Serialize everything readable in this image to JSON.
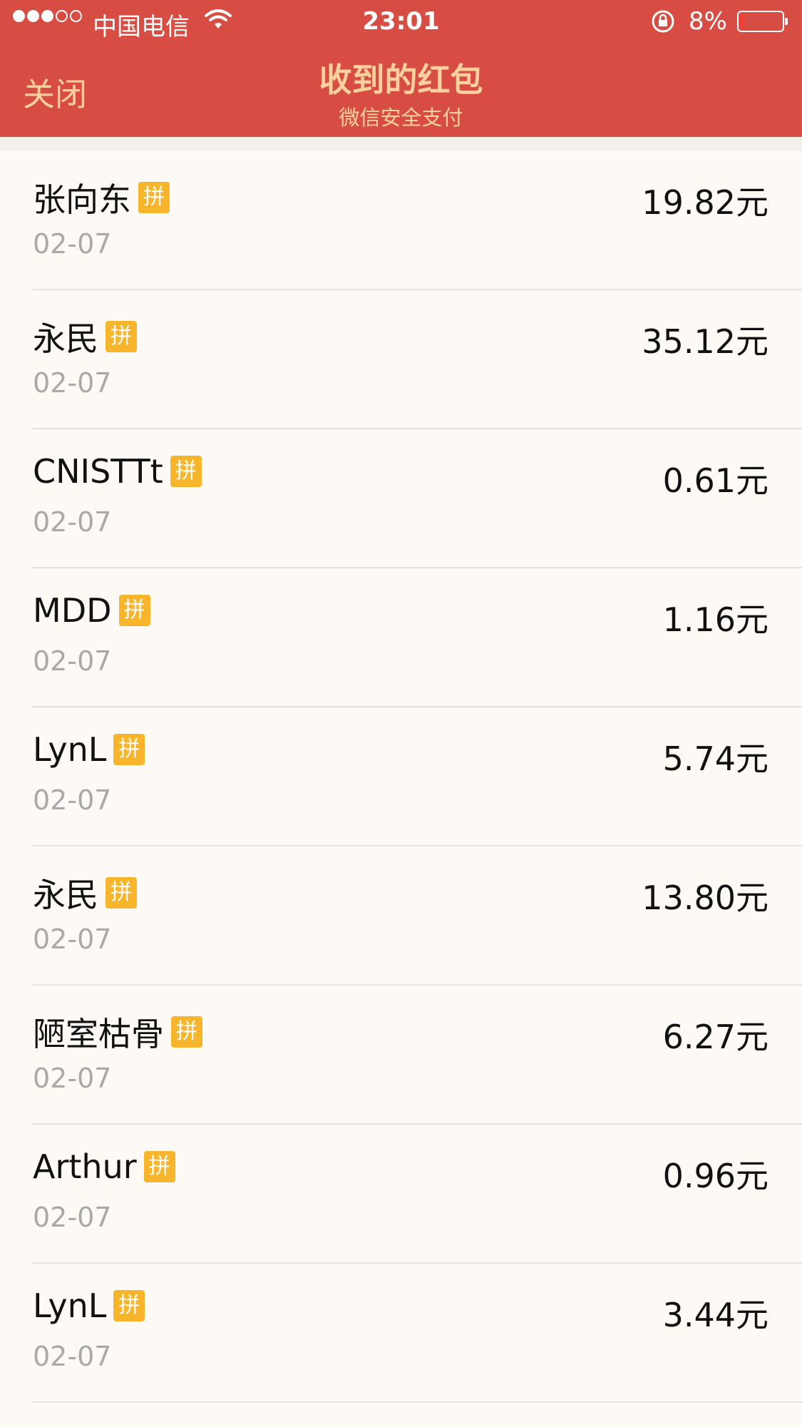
{
  "status_bar": {
    "carrier": "中国电信",
    "time": "23:01",
    "battery_percent": "8%",
    "battery_level": 0.08,
    "battery_color": "#ff3b30"
  },
  "header": {
    "close_label": "关闭",
    "title": "收到的红包",
    "subtitle": "微信安全支付",
    "background_color": "#d74d43",
    "text_color": "#fad19d"
  },
  "badge_label": "拼",
  "badge_color": "#f7b52c",
  "records": [
    {
      "name": "张向东",
      "badge": "拼",
      "date": "02-07",
      "amount": "19.82元"
    },
    {
      "name": "永民",
      "badge": "拼",
      "date": "02-07",
      "amount": "35.12元"
    },
    {
      "name": "CNISTTt",
      "badge": "拼",
      "date": "02-07",
      "amount": "0.61元"
    },
    {
      "name": "MDD",
      "badge": "拼",
      "date": "02-07",
      "amount": "1.16元"
    },
    {
      "name": "LynL",
      "badge": "拼",
      "date": "02-07",
      "amount": "5.74元"
    },
    {
      "name": "永民",
      "badge": "拼",
      "date": "02-07",
      "amount": "13.80元"
    },
    {
      "name": "陋室枯骨",
      "badge": "拼",
      "date": "02-07",
      "amount": "6.27元"
    },
    {
      "name": "Arthur",
      "badge": "拼",
      "date": "02-07",
      "amount": "0.96元"
    },
    {
      "name": "LynL",
      "badge": "拼",
      "date": "02-07",
      "amount": "3.44元"
    }
  ]
}
